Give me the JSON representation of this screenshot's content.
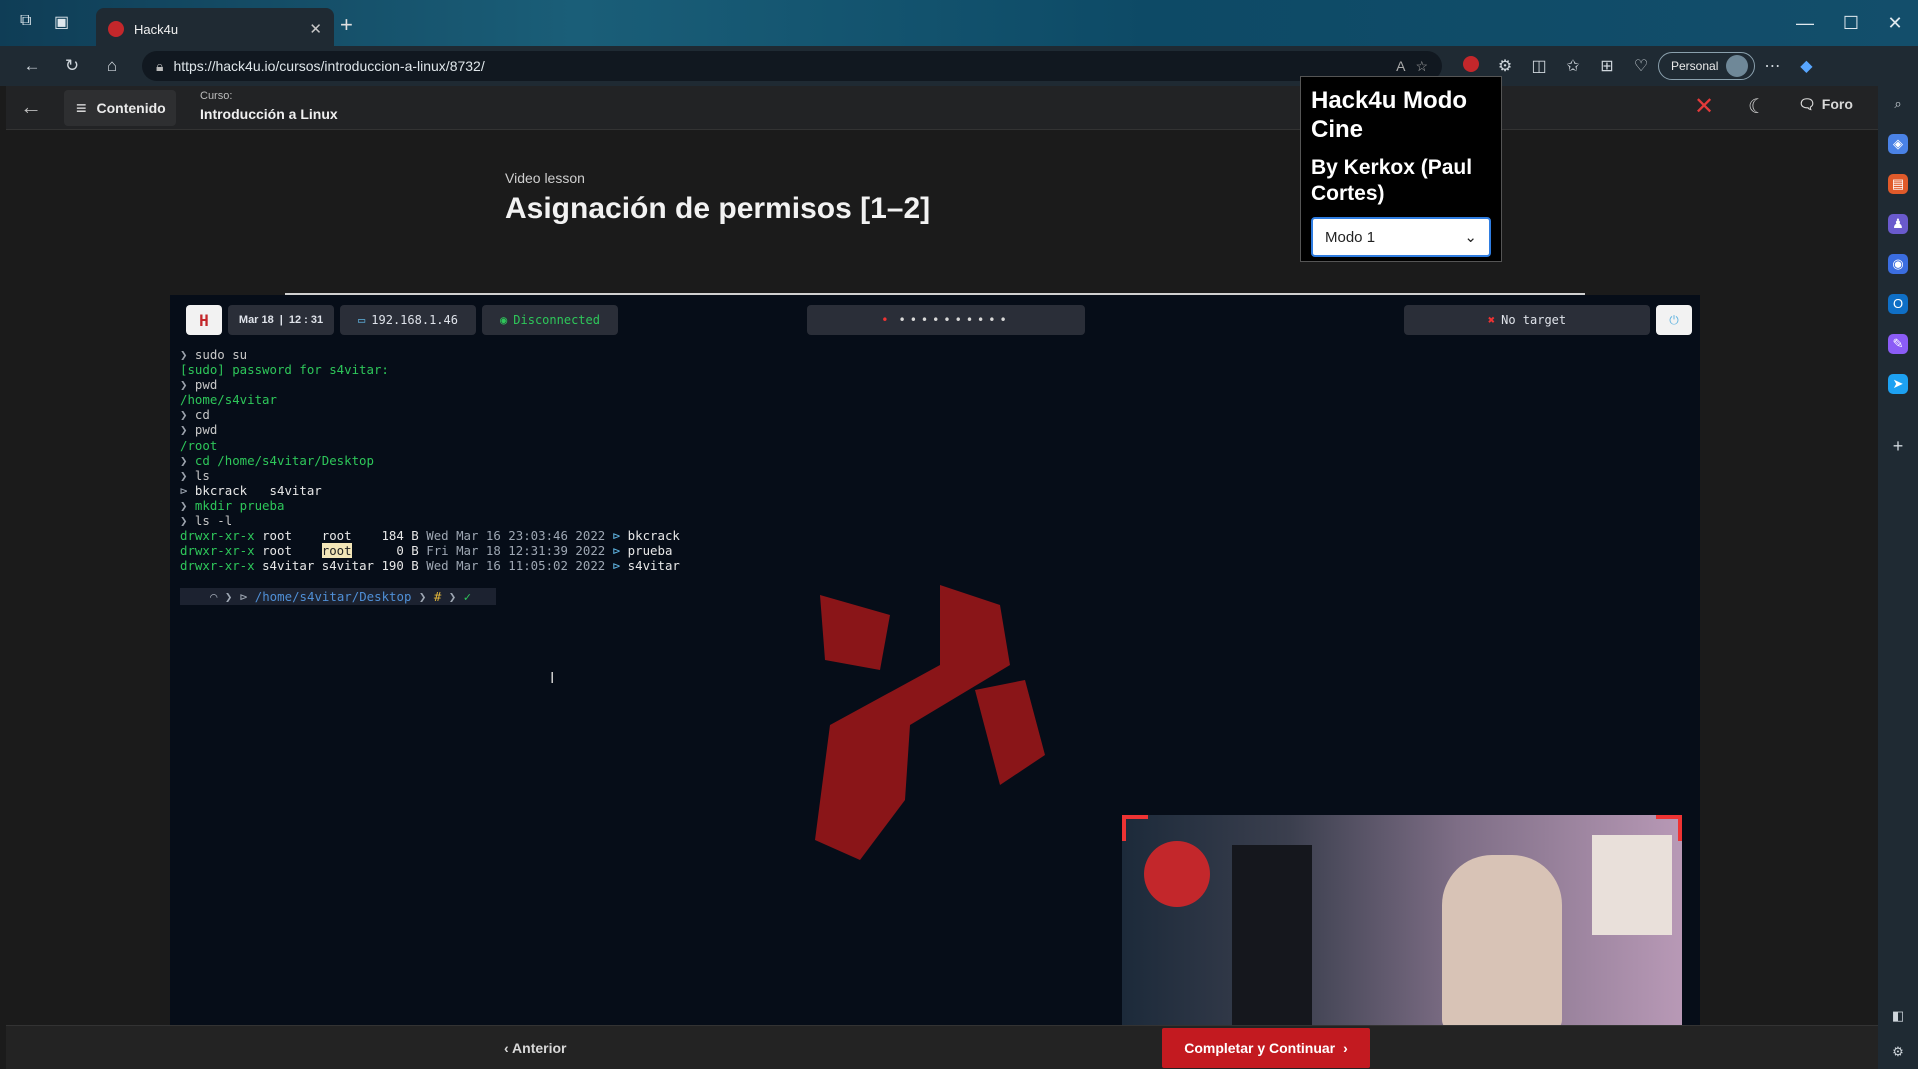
{
  "browser": {
    "tab_title": "Hack4u",
    "url": "https://hack4u.io/cursos/introduccion-a-linux/8732/",
    "profile_label": "Personal"
  },
  "header": {
    "contenido_label": "Contenido",
    "course_kicker": "Curso:",
    "course_name": "Introducción a Linux",
    "foro_label": "Foro"
  },
  "popup": {
    "title": "Hack4u Modo Cine",
    "subtitle": "By Kerkox (Paul Cortes)",
    "mode_value": "Modo 1"
  },
  "lesson": {
    "kicker": "Video lesson",
    "title": "Asignación de permisos [1–2]"
  },
  "video_topbar": {
    "date": "Mar 18",
    "time": "12 : 31",
    "ip": "192.168.1.46",
    "status": "Disconnected",
    "target": "No target"
  },
  "terminal": {
    "lines": [
      "sudo su",
      "[sudo] password for s4vitar:",
      "pwd",
      "/home/s4vitar",
      "cd",
      "pwd",
      "/root",
      "cd /home/s4vitar/Desktop",
      "ls",
      "bkcrack   s4vitar",
      "mkdir prueba",
      "ls -l"
    ],
    "listing": [
      {
        "perm": "drwxr-xr-x",
        "user": "root",
        "group": "root",
        "size": "184 B",
        "date": "Wed Mar 16 23:03:46 2022",
        "name": "bkcrack"
      },
      {
        "perm": "drwxr-xr-x",
        "user": "root",
        "group": "root",
        "size": "0 B",
        "date": "Fri Mar 18 12:31:39 2022",
        "name": "prueba"
      },
      {
        "perm": "drwxr-xr-x",
        "user": "s4vitar",
        "group": "s4vitar",
        "size": "190 B",
        "date": "Wed Mar 16 11:05:02 2022",
        "name": "s4vitar"
      }
    ],
    "prompt_path": "/home/s4vitar/Desktop",
    "prompt_symbol": "#"
  },
  "footer": {
    "anterior_label": "Anterior",
    "continuar_label": "Completar y Continuar"
  },
  "colors": {
    "accent_red": "#c31a20",
    "terminal_green": "#2ec75a"
  },
  "icons": [
    "back-arrow-icon",
    "menu-icon",
    "close-icon",
    "moon-icon",
    "forum-icon",
    "chevron-down-icon",
    "chevron-left-icon",
    "chevron-right-icon"
  ]
}
